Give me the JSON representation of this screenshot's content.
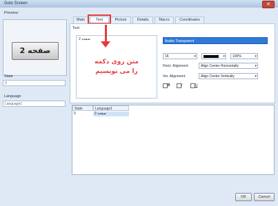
{
  "window": {
    "title": "Goto Screen",
    "close_glyph": "✕"
  },
  "left": {
    "preview_label": "Preview:",
    "preview_button_text": "صفحه 2",
    "state_label": "State",
    "state_value": "0",
    "language_label": "Language",
    "language_value": "Language1"
  },
  "tabs": [
    "Main",
    "Text",
    "Picture",
    "Details",
    "Macro",
    "Coordinates"
  ],
  "text_panel": {
    "group_label": "Text",
    "text_value": "2 صفحه",
    "annotation_line1": "متن روی دکمه",
    "annotation_line2": "را می نویسیم",
    "font_value": "Arabic Transparent",
    "size_value": "16",
    "zoom_value": "100%",
    "horiz_label": "Horiz. Alignment:",
    "horiz_value": "Align Center Horizontally",
    "vert_label": "Ver. Alignment:",
    "vert_value": "Align Center Vertically",
    "bold_label": "B",
    "italic_label": "I",
    "underline_label": "U",
    "accent_color": "#e23b3b"
  },
  "grid": {
    "headers": [
      "State",
      "Language1"
    ],
    "rows": [
      {
        "state": "0",
        "lang": "2 صفحه"
      }
    ]
  },
  "buttons": {
    "ok": "OK",
    "cancel": "Cancel"
  }
}
